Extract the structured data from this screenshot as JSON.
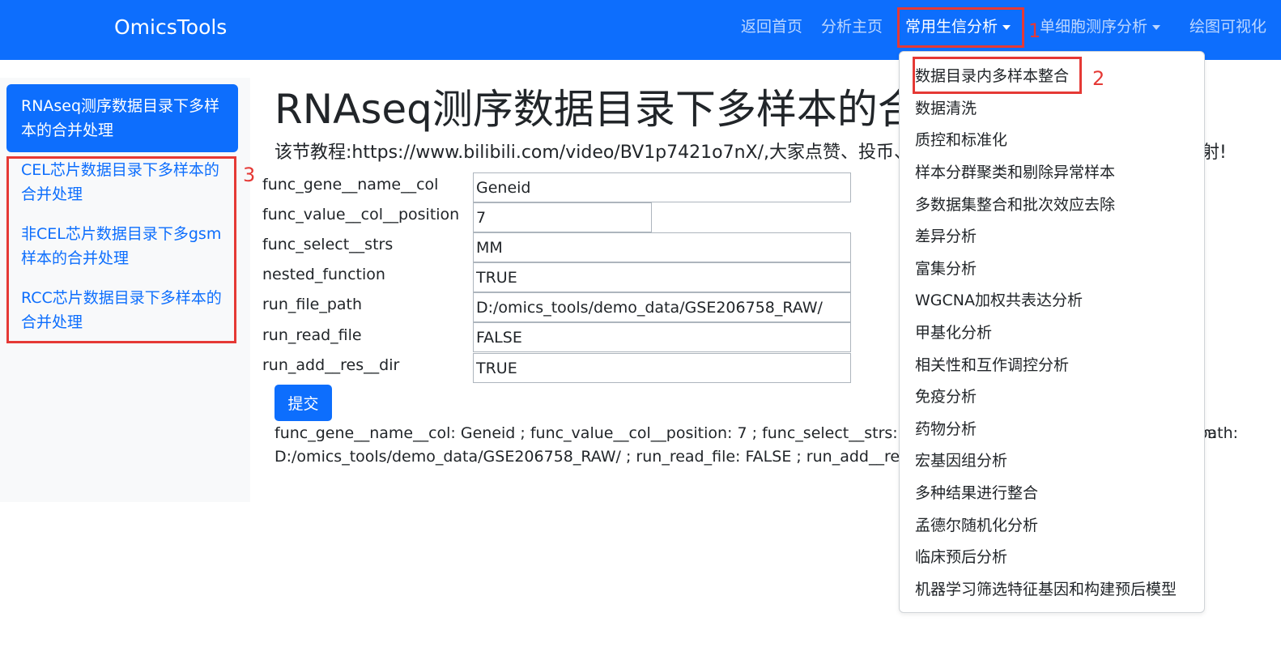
{
  "navbar": {
    "brand": "OmicsTools",
    "links": [
      {
        "label": "返回首页"
      },
      {
        "label": "分析主页"
      },
      {
        "label": "常用生信分析"
      },
      {
        "label": "单细胞测序分析"
      },
      {
        "label": "绘图可视化"
      }
    ]
  },
  "annotations": {
    "n1": "1",
    "n2": "2",
    "n3": "3"
  },
  "sidebar": {
    "items": [
      {
        "label": "RNAseq测序数据目录下多样本的合并处理"
      },
      {
        "label": "CEL芯片数据目录下多样本的合并处理"
      },
      {
        "label": "非CEL芯片数据目录下多gsm样本的合并处理"
      },
      {
        "label": "RCC芯片数据目录下多样本的合并处理"
      }
    ]
  },
  "main": {
    "title": "RNAseq测序数据目录下多样本的合并处理",
    "tutorial": "该节教程:https://www.bilibili.com/video/BV1p7421o7nX/,大家点赞、投币、收藏三连支持，不胜感激，谢谢",
    "tutorial_end": "射!",
    "form": [
      {
        "label": "func_gene__name__col",
        "value": "Geneid"
      },
      {
        "label": "func_value__col__position",
        "value": "7"
      },
      {
        "label": "func_select__strs",
        "value": "MM"
      },
      {
        "label": "nested_function",
        "value": "TRUE"
      },
      {
        "label": "run_file_path",
        "value": "D:/omics_tools/demo_data/GSE206758_RAW/"
      },
      {
        "label": "run_read_file",
        "value": "FALSE"
      },
      {
        "label": "run_add__res__dir",
        "value": "TRUE"
      }
    ],
    "submit_label": "提交",
    "result_line1": "func_gene__name__col: Geneid ; func_value__col__position: 7 ; func_select__strs: MM ; nested_function: TRUE ; run_file_path:",
    "result_line1_tail": "h:",
    "result_line2": "D:/omics_tools/demo_data/GSE206758_RAW/ ; run_read_file: FALSE ; run_add__res__dir: TRUE"
  },
  "dropdown": {
    "items": [
      {
        "label": "数据目录内多样本整合"
      },
      {
        "label": "数据清洗"
      },
      {
        "label": "质控和标准化"
      },
      {
        "label": "样本分群聚类和剔除异常样本"
      },
      {
        "label": "多数据集整合和批次效应去除"
      },
      {
        "label": "差异分析"
      },
      {
        "label": "富集分析"
      },
      {
        "label": "WGCNA加权共表达分析"
      },
      {
        "label": "甲基化分析"
      },
      {
        "label": "相关性和互作调控分析"
      },
      {
        "label": "免疫分析"
      },
      {
        "label": "药物分析"
      },
      {
        "label": "宏基因组分析"
      },
      {
        "label": "多种结果进行整合"
      },
      {
        "label": "孟德尔随机化分析"
      },
      {
        "label": "临床预后分析"
      },
      {
        "label": "机器学习筛选特征基因和构建预后模型"
      }
    ]
  },
  "colors": {
    "primary": "#0d6efd",
    "annotation": "#e53935"
  }
}
